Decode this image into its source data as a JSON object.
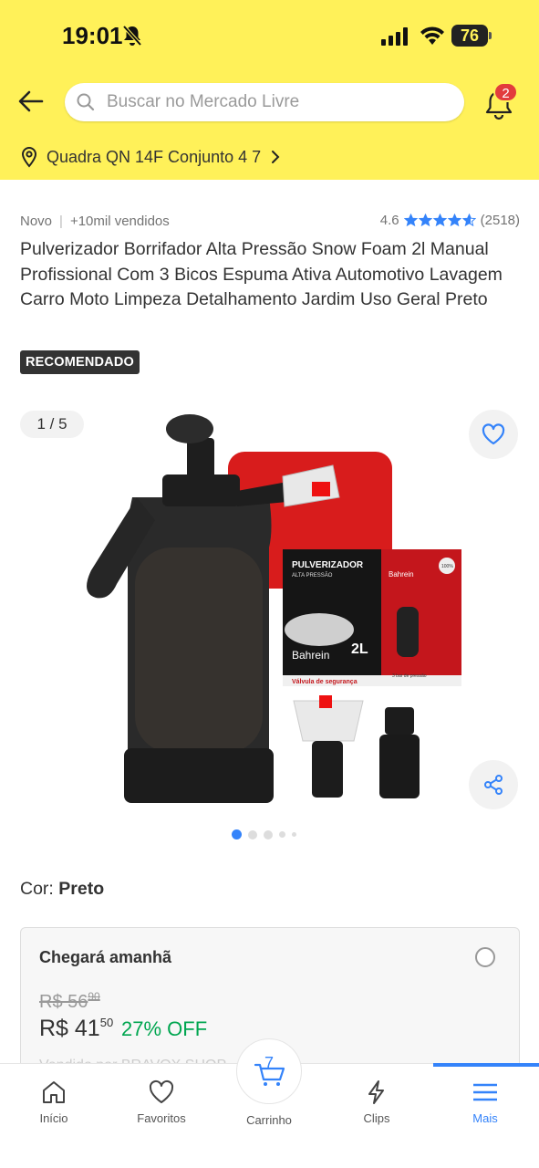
{
  "status_bar": {
    "time": "19:01",
    "battery": "76"
  },
  "header": {
    "search_placeholder": "Buscar no Mercado Livre",
    "notification_count": "2",
    "address": "Quadra QN 14F Conjunto 4 7"
  },
  "product": {
    "condition": "Novo",
    "sold": "+10mil vendidos",
    "rating": "4.6",
    "rating_stars": 4.6,
    "review_count": "(2518)",
    "title": "Pulverizador Borrifador Alta Pressão Snow Foam 2l Manual Profissional Com 3 Bicos Espuma Ativa Automotivo Lavagem Carro Moto Limpeza Detalhamento Jardim Uso Geral Preto",
    "badge": "RECOMENDADO",
    "image_counter": "1 / 5",
    "image_box_texts": {
      "brand": "Bahrein",
      "title": "PULVERIZADOR",
      "subtitle": "ALTA PRESSÃO",
      "capacity": "2L",
      "safety": "Válvula de segurança",
      "pressure": "3 bar de pressão",
      "seal": "100%"
    },
    "color_label": "Cor:",
    "color_value": "Preto"
  },
  "shipping": {
    "title": "Chegará amanhã",
    "old_price_int": "R$ 56",
    "old_price_cents": "90",
    "new_price_int": "R$ 41",
    "new_price_cents": "50",
    "discount": "27% OFF",
    "seller_peek": "Vendido por BRAVOX SHOP"
  },
  "bottom_nav": {
    "items": [
      {
        "label": "Início",
        "icon": "home-icon"
      },
      {
        "label": "Favoritos",
        "icon": "heart-icon"
      },
      {
        "label": "Carrinho",
        "icon": "cart-icon"
      },
      {
        "label": "Clips",
        "icon": "clips-icon"
      },
      {
        "label": "Mais",
        "icon": "menu-icon"
      }
    ],
    "cart_count": "7",
    "active": "Mais"
  },
  "colors": {
    "header_bg": "#fff159",
    "accent_blue": "#3483fa",
    "discount_green": "#00a650",
    "badge_red": "#e23c3c"
  }
}
